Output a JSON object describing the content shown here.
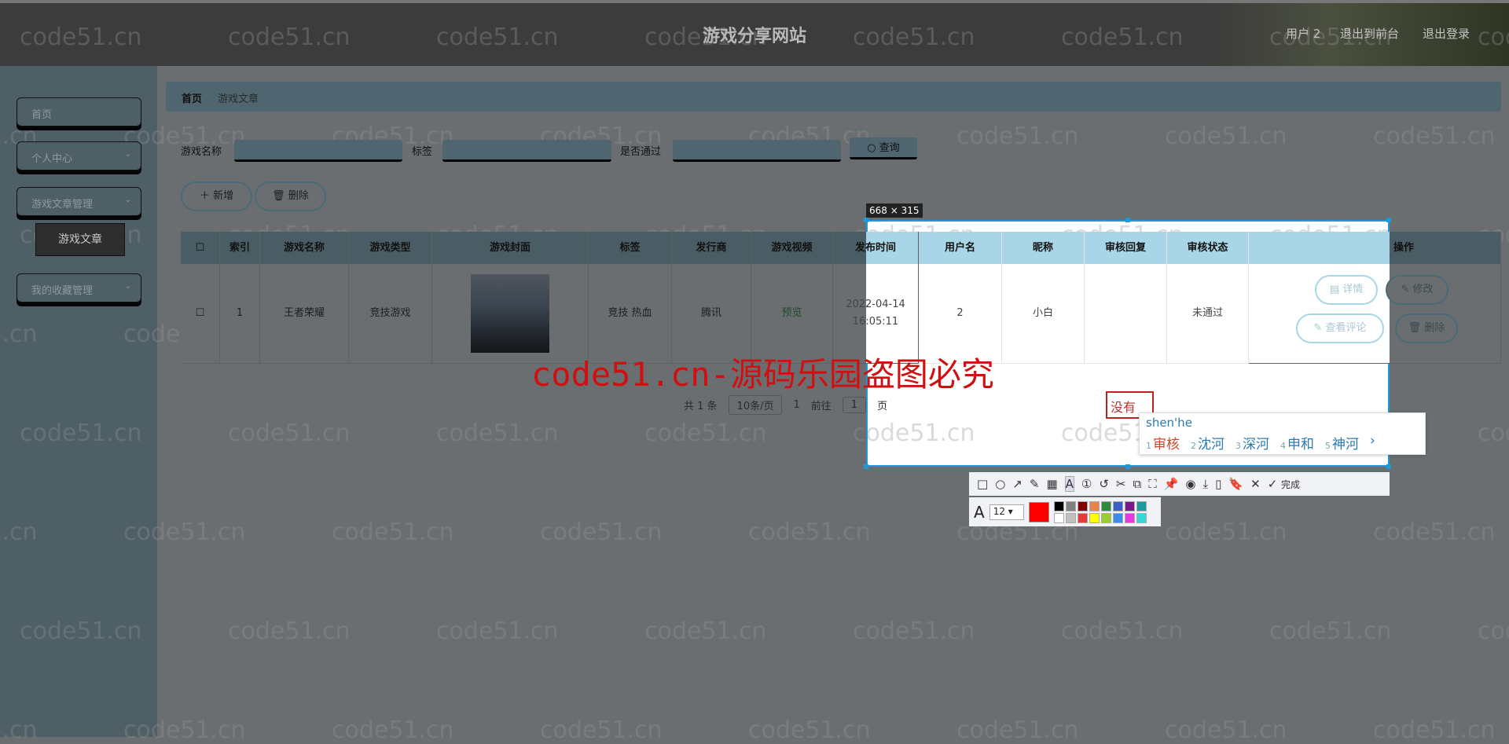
{
  "header": {
    "title": "游戏分享网站",
    "links": [
      "用户 2",
      "退出到前台",
      "退出登录"
    ]
  },
  "sidebar": {
    "items": [
      {
        "label": "首页"
      },
      {
        "label": "个人中心",
        "chevron": true
      },
      {
        "label": "游戏文章管理",
        "chevron": true
      },
      {
        "label": "我的收藏管理",
        "chevron": true
      }
    ],
    "sub_item": "游戏文章"
  },
  "breadcrumb": [
    "首页",
    "游戏文章"
  ],
  "search": {
    "fields": [
      {
        "label": "游戏名称",
        "value": ""
      },
      {
        "label": "标签",
        "value": ""
      },
      {
        "label": "是否通过",
        "value": ""
      }
    ],
    "query_label": "查询",
    "query_icon": "search-icon"
  },
  "actions": {
    "add": "新增",
    "delete": "删除",
    "add_icon": "plus-icon",
    "delete_icon": "trash-icon"
  },
  "table": {
    "columns": [
      "",
      "索引",
      "游戏名称",
      "游戏类型",
      "游戏封面",
      "标签",
      "发行商",
      "游戏视频",
      "发布时间",
      "用户名",
      "昵称",
      "审核回复",
      "审核状态",
      "操作"
    ],
    "rows": [
      {
        "index": "1",
        "name": "王者荣耀",
        "type": "竞技游戏",
        "tags": "竞技 热血",
        "publisher": "腾讯",
        "video": "预览",
        "date": "2022-04-14",
        "time": "16:05:11",
        "username": "2",
        "nickname": "小白",
        "reply": "",
        "status": "未通过"
      }
    ],
    "ops": [
      "详情",
      "修改",
      "查看评论",
      "删除"
    ]
  },
  "pagination": {
    "total": "共 1 条",
    "page_size": "10条/页",
    "page": "1",
    "goto": "前往",
    "goto_value": "1",
    "page_unit": "页"
  },
  "watermark": "code51.cn",
  "big_watermark": "code51.cn-源码乐园盗图必究",
  "screenshot_tool": {
    "size_label": "668 × 315",
    "text_value": "没有",
    "ime": {
      "pinyin": "shen'he",
      "candidates": [
        "审核",
        "沈河",
        "深河",
        "申和",
        "神河"
      ],
      "more": "›"
    },
    "tools": [
      "□",
      "○",
      "↗",
      "✎",
      "▦",
      "A",
      "①",
      "↺",
      "✂",
      "⧉",
      "⛶",
      "📌",
      "◉",
      "⤓",
      "▯",
      "🔖",
      "✕"
    ],
    "done": "完成",
    "font_size": "12",
    "current_color": "#ff0000",
    "palette": [
      "#000000",
      "#808080",
      "#800000",
      "#e6844a",
      "#2e8b3a",
      "#3a5fc8",
      "#7a1a8a",
      "#1a9a9a",
      "#ffffff",
      "#c0c0c0",
      "#e83a3a",
      "#ffff00",
      "#9acd32",
      "#3a8ee6",
      "#e838e0",
      "#38d8d8"
    ]
  },
  "colors": {
    "accent": "#a8d6e6",
    "selection": "#1e9bd7",
    "watermark_red": "#d01010"
  }
}
